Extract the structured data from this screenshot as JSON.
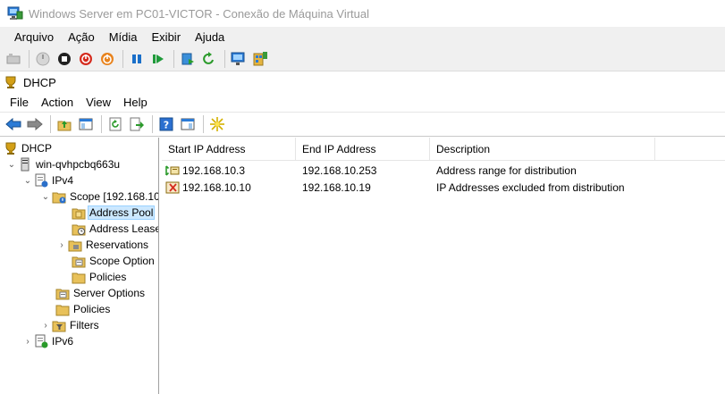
{
  "window": {
    "title": "Windows Server em PC01-VICTOR - Conexão de Máquina Virtual"
  },
  "vm_menu": [
    "Arquivo",
    "Ação",
    "Mídia",
    "Exibir",
    "Ajuda"
  ],
  "vm_toolbar": [
    "ctrl-alt-del-icon",
    "start-icon",
    "turn-off-icon",
    "shut-down-icon",
    "save-state-icon",
    "pause-icon",
    "resume-icon",
    "checkpoint-icon",
    "revert-icon",
    "enhanced-session-icon",
    "zoom-icon"
  ],
  "mmc": {
    "title": "DHCP",
    "menu": [
      "File",
      "Action",
      "View",
      "Help"
    ]
  },
  "tree": {
    "root": "DHCP",
    "server": "win-qvhpcbq663u",
    "ipv4": "IPv4",
    "scope": "Scope [192.168.10",
    "address_pool": "Address Pool",
    "address_leases": "Address Lease",
    "reservations": "Reservations",
    "scope_options": "Scope Option",
    "scope_policies": "Policies",
    "server_options": "Server Options",
    "policies": "Policies",
    "filters": "Filters",
    "ipv6": "IPv6"
  },
  "list": {
    "columns": [
      "Start IP Address",
      "End IP Address",
      "Description"
    ],
    "rows": [
      {
        "start": "192.168.10.3",
        "end": "192.168.10.253",
        "description": "Address range for distribution",
        "icon": "address-range-icon"
      },
      {
        "start": "192.168.10.10",
        "end": "192.168.10.19",
        "description": "IP Addresses excluded from distribution",
        "icon": "exclusion-range-icon"
      }
    ]
  },
  "colors": {
    "selection": "#cce8ff",
    "selection_border": "#99d1ff",
    "title_text": "#9a9a9a",
    "toolbar_bg": "#f0f0f0"
  }
}
